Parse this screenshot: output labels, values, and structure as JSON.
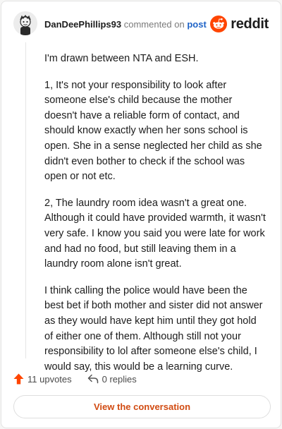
{
  "header": {
    "username": "DanDeePhillips93",
    "meta_text": "commented on",
    "post_link": "post",
    "brand_name": "reddit",
    "brand_color": "#ff4500"
  },
  "comment": {
    "paragraphs": [
      "I'm drawn between NTA and ESH.",
      "1, It's not your responsibility to look after someone else's child because the mother doesn't have a reliable form of contact, and should know exactly when her sons school is open. She in a sense neglected her child as she didn't even bother to check if the school was open or not etc.",
      "2, The laundry room idea wasn't a great one. Although it could have provided warmth, it wasn't very safe. I know you said you were late for work and had no food, but still leaving them in a laundry room alone isn't great.",
      "I think calling the police would have been the best bet if both mother and sister did not answer as they would have kept him until they got hold of either one of them. Although still not your responsibility to lol after someone else's child, I would say, this would be a learning curve."
    ]
  },
  "actions": {
    "upvotes": "11 upvotes",
    "upvote_icon": "upvote-arrow-icon",
    "upvote_color": "#ff4500",
    "replies": "0 replies",
    "reply_icon": "reply-arrow-icon"
  },
  "footer": {
    "view_button": "View the conversation",
    "accent": "#d14b12"
  }
}
